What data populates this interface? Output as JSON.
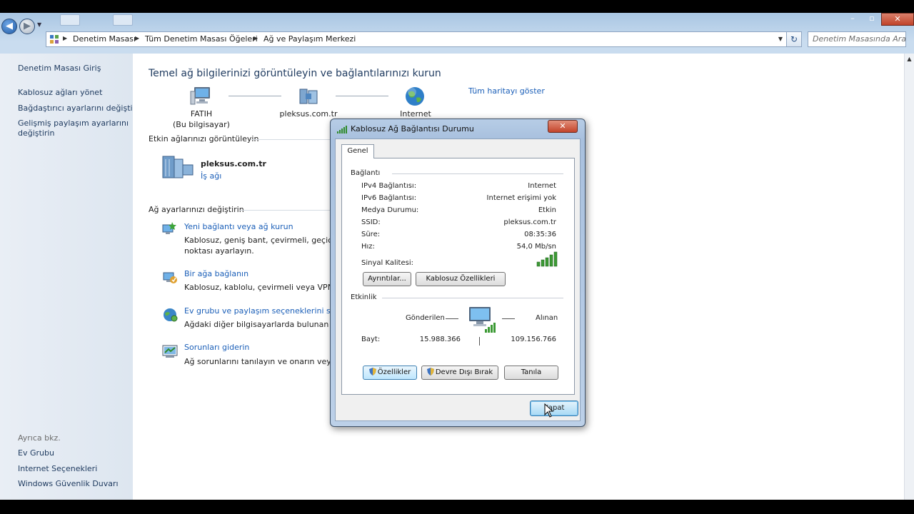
{
  "nav": {
    "breadcrumbs": [
      "Denetim Masası",
      "Tüm Denetim Masası Öğeleri",
      "Ağ ve Paylaşım Merkezi"
    ],
    "search_placeholder": "Denetim Masasında Ara"
  },
  "sidebar": {
    "items": [
      {
        "label": "Denetim Masası Giriş"
      },
      {
        "label": "Kablosuz ağları yönet"
      },
      {
        "label": "Bağdaştırıcı ayarlarını değiştirin"
      },
      {
        "label": "Gelişmiş paylaşım ayarlarını"
      },
      {
        "label": "değiştirin"
      }
    ],
    "see_also_label": "Ayrıca bkz.",
    "see_also": [
      {
        "label": "Ev Grubu"
      },
      {
        "label": "Internet Seçenekleri"
      },
      {
        "label": "Windows Güvenlik Duvarı"
      }
    ]
  },
  "main": {
    "title": "Temel ağ bilgilerinizi görüntüleyin ve bağlantılarınızı kurun",
    "map": {
      "computer_name": "FATIH",
      "computer_sub": "(Bu bilgisayar)",
      "network_name": "pleksus.com.tr",
      "internet_label": "Internet",
      "full_map_link": "Tüm haritayı göster"
    },
    "active_networks_heading": "Etkin ağlarınızı görüntüleyin",
    "active_network": {
      "name": "pleksus.com.tr",
      "type": "İş ağı"
    },
    "change_settings_heading": "Ağ ayarlarınızı değiştirin",
    "tasks": [
      {
        "link": "Yeni bağlantı veya ağ kurun",
        "desc1": "Kablosuz, geniş bant, çevirmeli, geçici ve",
        "desc2": "noktası ayarlayın."
      },
      {
        "link": "Bir ağa bağlanın",
        "desc1": "Kablosuz, kablolu, çevirmeli veya VPN ağ",
        "desc2": ""
      },
      {
        "link": "Ev grubu ve paylaşım seçeneklerini seçin",
        "desc1": "Ağdaki diğer bilgisayarlarda bulunan dos",
        "desc2": ""
      },
      {
        "link": "Sorunları giderin",
        "desc1": "Ağ sorunlarını tanılayın ve onarın veya so",
        "desc2": ""
      }
    ]
  },
  "dialog": {
    "title": "Kablosuz Ağ Bağlantısı Durumu",
    "close_glyph": "✕",
    "tab_label": "Genel",
    "connection_group": "Bağlantı",
    "rows": [
      {
        "key": "IPv4 Bağlantısı:",
        "value": "Internet"
      },
      {
        "key": "IPv6 Bağlantısı:",
        "value": "Internet erişimi yok"
      },
      {
        "key": "Medya Durumu:",
        "value": "Etkin"
      },
      {
        "key": "SSID:",
        "value": "pleksus.com.tr"
      },
      {
        "key": "Süre:",
        "value": "08:35:36"
      },
      {
        "key": "Hız:",
        "value": "54,0 Mb/sn"
      }
    ],
    "signal_label": "Sinyal Kalitesi:",
    "signal_bars": 5,
    "details_button": "Ayrıntılar...",
    "wireless_props_button": "Kablosuz Özellikleri",
    "activity_group": "Etkinlik",
    "sent_label": "Gönderilen",
    "received_label": "Alınan",
    "bytes_label": "Bayt:",
    "bytes_sent": "15.988.366",
    "bytes_received": "109.156.766",
    "properties_button": "Özellikler",
    "disable_button": "Devre Dışı Bırak",
    "diagnose_button": "Tanıla",
    "close_button": "Kapat"
  }
}
